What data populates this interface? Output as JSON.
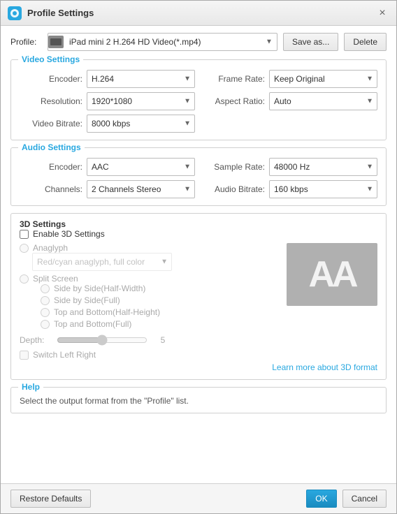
{
  "window": {
    "title": "Profile Settings",
    "close_label": "×"
  },
  "profile": {
    "label": "Profile:",
    "value": "iPad mini 2 H.264 HD Video(*.mp4)",
    "options": [
      "iPad mini 2 H.264 HD Video(*.mp4)"
    ],
    "save_as_label": "Save as...",
    "delete_label": "Delete"
  },
  "video_settings": {
    "title": "Video Settings",
    "encoder_label": "Encoder:",
    "encoder_value": "H.264",
    "encoder_options": [
      "H.264"
    ],
    "resolution_label": "Resolution:",
    "resolution_value": "1920*1080",
    "resolution_options": [
      "1920*1080"
    ],
    "video_bitrate_label": "Video Bitrate:",
    "video_bitrate_value": "8000 kbps",
    "video_bitrate_options": [
      "8000 kbps"
    ],
    "frame_rate_label": "Frame Rate:",
    "frame_rate_value": "Keep Original",
    "frame_rate_options": [
      "Keep Original"
    ],
    "aspect_ratio_label": "Aspect Ratio:",
    "aspect_ratio_value": "Auto",
    "aspect_ratio_options": [
      "Auto"
    ]
  },
  "audio_settings": {
    "title": "Audio Settings",
    "encoder_label": "Encoder:",
    "encoder_value": "AAC",
    "encoder_options": [
      "AAC"
    ],
    "channels_label": "Channels:",
    "channels_value": "2 Channels Stereo",
    "channels_options": [
      "2 Channels Stereo"
    ],
    "sample_rate_label": "Sample Rate:",
    "sample_rate_value": "48000 Hz",
    "sample_rate_options": [
      "48000 Hz"
    ],
    "audio_bitrate_label": "Audio Bitrate:",
    "audio_bitrate_value": "160 kbps",
    "audio_bitrate_options": [
      "160 kbps"
    ]
  },
  "settings_3d": {
    "title": "3D Settings",
    "enable_label": "Enable 3D Settings",
    "anaglyph_label": "Anaglyph",
    "anaglyph_value": "Red/cyan anaglyph, full color",
    "anaglyph_options": [
      "Red/cyan anaglyph, full color"
    ],
    "split_screen_label": "Split Screen",
    "split_options": [
      "Side by Side(Half-Width)",
      "Side by Side(Full)",
      "Top and Bottom(Half-Height)",
      "Top and Bottom(Full)"
    ],
    "depth_label": "Depth:",
    "depth_value": "5",
    "switch_label": "Switch Left Right",
    "learn_more": "Learn more about 3D format",
    "preview_text": "AA"
  },
  "help": {
    "title": "Help",
    "text": "Select the output format from the \"Profile\" list."
  },
  "footer": {
    "restore_label": "Restore Defaults",
    "ok_label": "OK",
    "cancel_label": "Cancel"
  }
}
